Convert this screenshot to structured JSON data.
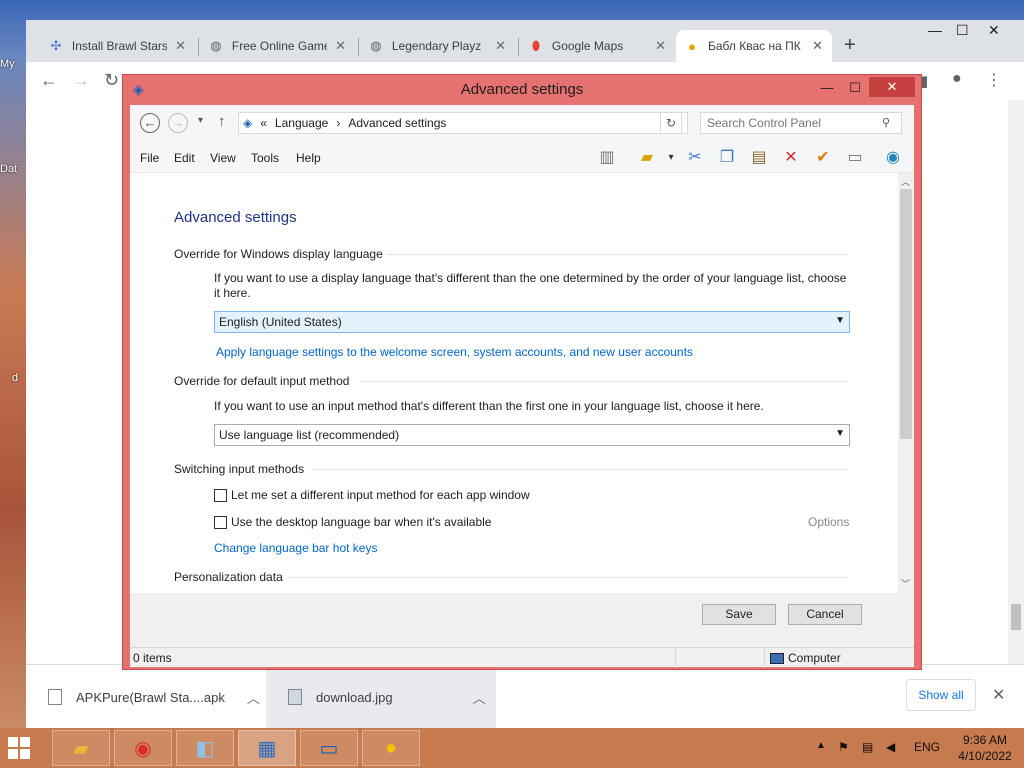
{
  "desktop": {
    "labels": [
      "My",
      "Dat",
      "d"
    ]
  },
  "browser": {
    "tabs": [
      {
        "title": "Install Brawl Stars",
        "icon": "puzzle-icon"
      },
      {
        "title": "Free Online Games",
        "icon": "globe-icon"
      },
      {
        "title": "Legendary Playz",
        "icon": "globe-icon"
      },
      {
        "title": "Google Maps",
        "icon": "maps-pin-icon"
      },
      {
        "title": "Бабл Квас на ПК",
        "icon": "bubble-icon"
      }
    ],
    "new_tab": "+",
    "downloads": [
      {
        "name": "APKPure(Brawl Sta....apk"
      },
      {
        "name": "download.jpg"
      }
    ],
    "show_all": "Show all"
  },
  "window": {
    "title": "Advanced settings",
    "breadcrumb": [
      "«",
      "Language",
      "›",
      "Advanced settings"
    ],
    "search_placeholder": "Search Control Panel",
    "menu": [
      "File",
      "Edit",
      "View",
      "Tools",
      "Help"
    ],
    "toolbar_icons": [
      "layout-icon",
      "folder-check-icon",
      "cut-icon",
      "copy-icon",
      "paste-icon",
      "delete-icon",
      "check-icon",
      "properties-icon",
      "globe-icon"
    ]
  },
  "page": {
    "heading": "Advanced settings",
    "override_display": {
      "title": "Override for Windows display language",
      "desc": "If you want to use a display language that's different than the one determined by the order of your language list, choose it here.",
      "selected": "English (United States)",
      "link": "Apply language settings to the welcome screen, system accounts, and new user accounts"
    },
    "override_input": {
      "title": "Override for default input method",
      "desc": "If you want to use an input method that's different than the first one in your language list, choose it here.",
      "selected": "Use language list (recommended)"
    },
    "switching": {
      "title": "Switching input methods",
      "option1": "Let me set a different input method for each app window",
      "option2": "Use the desktop language bar when it's available",
      "options_link": "Options",
      "hotkeys_link": "Change language bar hot keys"
    },
    "personalization": {
      "title": "Personalization data"
    }
  },
  "buttons": {
    "save": "Save",
    "cancel": "Cancel"
  },
  "status": {
    "items": "0 items",
    "location": "Computer"
  },
  "taskbar": {
    "lang": "ENG",
    "time": "9:36 AM",
    "date": "4/10/2022"
  }
}
